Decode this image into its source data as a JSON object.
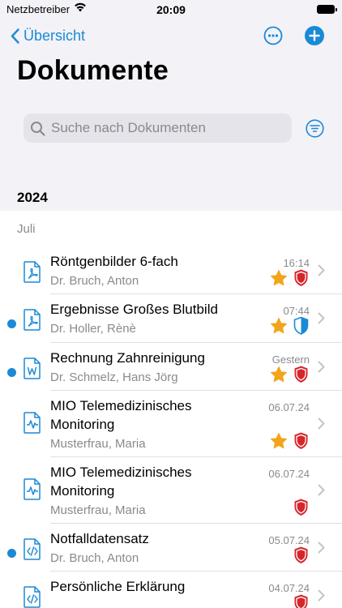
{
  "status_bar": {
    "carrier": "Netzbetreiber",
    "time": "20:09"
  },
  "nav": {
    "back_label": "Übersicht"
  },
  "page": {
    "title": "Dokumente"
  },
  "search": {
    "placeholder": "Suche nach Dokumenten",
    "value": ""
  },
  "section": {
    "year": "2024",
    "month": "Juli"
  },
  "colors": {
    "accent": "#1a8ad6",
    "star": "#f2a51a",
    "shield_red": "#d6262b",
    "shield_blue": "#1a8ad6"
  },
  "documents": [
    {
      "name": "Röntgenbilder 6-fach",
      "author": "Dr. Bruch, Anton",
      "date": "16:14",
      "icon": "pdf-icon",
      "starred": true,
      "shield": "red",
      "unread": false
    },
    {
      "name": "Ergebnisse Großes Blutbild",
      "author": "Dr. Holler, Rènè",
      "date": "07:44",
      "icon": "pdf-icon",
      "starred": true,
      "shield": "blue-half",
      "unread": true
    },
    {
      "name": "Rechnung Zahnreinigung",
      "author": "Dr. Schmelz, Hans Jörg",
      "date": "Gestern",
      "icon": "word-icon",
      "starred": true,
      "shield": "red",
      "unread": true
    },
    {
      "name": "MIO Telemedizinisches Monitoring",
      "author": "Musterfrau, Maria",
      "date": "06.07.24",
      "icon": "monitoring-icon",
      "starred": true,
      "shield": "red",
      "unread": false
    },
    {
      "name": "MIO Telemedizinisches Monitoring",
      "author": "Musterfrau, Maria",
      "date": "06.07.24",
      "icon": "monitoring-icon",
      "starred": false,
      "shield": "red",
      "unread": false
    },
    {
      "name": "Notfalldatensatz",
      "author": "Dr. Bruch, Anton",
      "date": "05.07.24",
      "icon": "code-icon",
      "starred": false,
      "shield": "red",
      "unread": true
    },
    {
      "name": "Persönliche Erklärung",
      "author": "",
      "date": "04.07.24",
      "icon": "code-icon",
      "starred": false,
      "shield": "red",
      "unread": false
    }
  ]
}
